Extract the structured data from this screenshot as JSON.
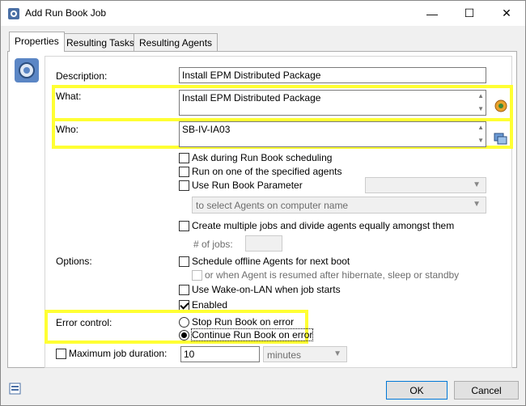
{
  "window": {
    "title": "Add Run Book Job",
    "minimize": "—",
    "maximize": "☐",
    "close": "✕"
  },
  "tabs": [
    "Properties",
    "Resulting Tasks",
    "Resulting Agents"
  ],
  "fields": {
    "description_label": "Description:",
    "description_value": "Install EPM Distributed Package",
    "what_label": "What:",
    "what_value": "Install EPM Distributed Package",
    "who_label": "Who:",
    "who_value": "SB-IV-IA03"
  },
  "checks": {
    "ask": "Ask during Run Book scheduling",
    "run_one": "Run on one of the specified agents",
    "use_param": "Use Run Book Parameter",
    "param_combo": "to select Agents on computer name",
    "create_multiple": "Create multiple jobs and divide agents equally amongst them",
    "num_jobs_label": "# of jobs:",
    "options_label": "Options:",
    "schedule_offline": "Schedule offline Agents for next boot",
    "resumed": "or when Agent is resumed after hibernate, sleep or standby",
    "wake_on_lan": "Use Wake-on-LAN when job starts",
    "enabled": "Enabled"
  },
  "error_control": {
    "label": "Error control:",
    "stop": "Stop Run Book on error",
    "continue": "Continue Run Book on error"
  },
  "duration": {
    "label": "Maximum job duration:",
    "value": "10",
    "unit": "minutes"
  },
  "buttons": {
    "ok": "OK",
    "cancel": "Cancel"
  },
  "colors": {
    "highlight": "#ffff33"
  }
}
